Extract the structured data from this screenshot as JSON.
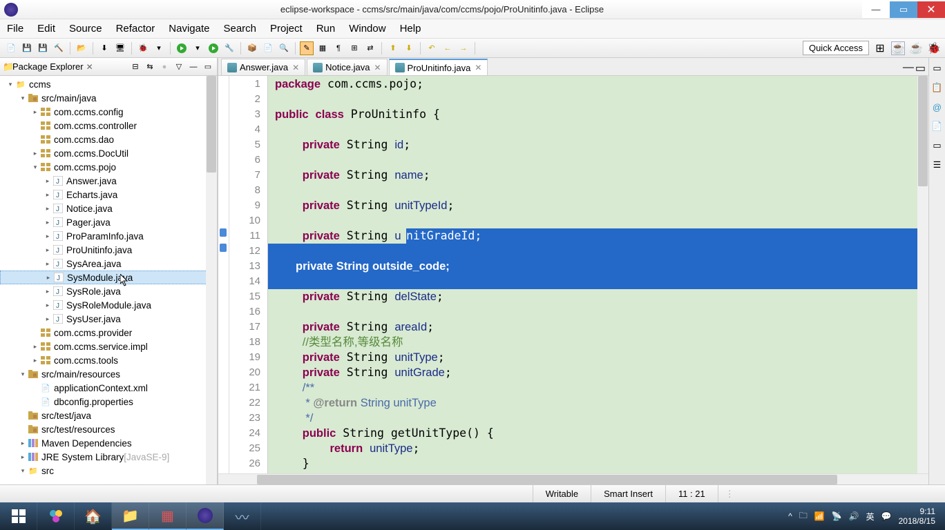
{
  "window": {
    "title": "eclipse-workspace - ccms/src/main/java/com/ccms/pojo/ProUnitinfo.java - Eclipse"
  },
  "menu": {
    "items": [
      "File",
      "Edit",
      "Source",
      "Refactor",
      "Navigate",
      "Search",
      "Project",
      "Run",
      "Window",
      "Help"
    ]
  },
  "quickaccess": "Quick Access",
  "explorer": {
    "title": "Package Explorer",
    "nodes": [
      {
        "d": 0,
        "tw": "▾",
        "icon": "project",
        "label": "ccms"
      },
      {
        "d": 1,
        "tw": "▾",
        "icon": "srcfolder",
        "label": "src/main/java"
      },
      {
        "d": 2,
        "tw": "▸",
        "icon": "pkg",
        "label": "com.ccms.config"
      },
      {
        "d": 2,
        "tw": "",
        "icon": "pkg",
        "label": "com.ccms.controller"
      },
      {
        "d": 2,
        "tw": "",
        "icon": "pkg",
        "label": "com.ccms.dao"
      },
      {
        "d": 2,
        "tw": "▸",
        "icon": "pkg",
        "label": "com.ccms.DocUtil"
      },
      {
        "d": 2,
        "tw": "▾",
        "icon": "pkg",
        "label": "com.ccms.pojo"
      },
      {
        "d": 3,
        "tw": "▸",
        "icon": "java",
        "label": "Answer.java"
      },
      {
        "d": 3,
        "tw": "▸",
        "icon": "java",
        "label": "Echarts.java"
      },
      {
        "d": 3,
        "tw": "▸",
        "icon": "java",
        "label": "Notice.java"
      },
      {
        "d": 3,
        "tw": "▸",
        "icon": "java",
        "label": "Pager.java"
      },
      {
        "d": 3,
        "tw": "▸",
        "icon": "java",
        "label": "ProParamInfo.java"
      },
      {
        "d": 3,
        "tw": "▸",
        "icon": "java",
        "label": "ProUnitinfo.java"
      },
      {
        "d": 3,
        "tw": "▸",
        "icon": "java",
        "label": "SysArea.java"
      },
      {
        "d": 3,
        "tw": "▸",
        "icon": "java",
        "label": "SysModule.java",
        "sel": true
      },
      {
        "d": 3,
        "tw": "▸",
        "icon": "java",
        "label": "SysRole.java"
      },
      {
        "d": 3,
        "tw": "▸",
        "icon": "java",
        "label": "SysRoleModule.java"
      },
      {
        "d": 3,
        "tw": "▸",
        "icon": "java",
        "label": "SysUser.java"
      },
      {
        "d": 2,
        "tw": "",
        "icon": "pkg",
        "label": "com.ccms.provider"
      },
      {
        "d": 2,
        "tw": "▸",
        "icon": "pkg",
        "label": "com.ccms.service.impl"
      },
      {
        "d": 2,
        "tw": "▸",
        "icon": "pkg",
        "label": "com.ccms.tools"
      },
      {
        "d": 1,
        "tw": "▾",
        "icon": "srcfolder",
        "label": "src/main/resources"
      },
      {
        "d": 2,
        "tw": "",
        "icon": "file",
        "label": "applicationContext.xml"
      },
      {
        "d": 2,
        "tw": "",
        "icon": "file",
        "label": "dbconfig.properties"
      },
      {
        "d": 1,
        "tw": "",
        "icon": "srcfolder",
        "label": "src/test/java"
      },
      {
        "d": 1,
        "tw": "",
        "icon": "srcfolder",
        "label": "src/test/resources"
      },
      {
        "d": 1,
        "tw": "▸",
        "icon": "lib",
        "label": "Maven Dependencies"
      },
      {
        "d": 1,
        "tw": "▸",
        "icon": "lib",
        "label": "JRE System Library",
        "extra": "[JavaSE-9]"
      },
      {
        "d": 1,
        "tw": "▾",
        "icon": "folder",
        "label": "src"
      }
    ]
  },
  "editor": {
    "tabs": [
      {
        "label": "Answer.java",
        "active": false
      },
      {
        "label": "Notice.java",
        "active": false
      },
      {
        "label": "ProUnitinfo.java",
        "active": true
      }
    ],
    "lines_start": 1,
    "lines_end": 26,
    "code_html": "<span class='kw'>package</span> com.ccms.pojo;\n\n<span class='kw'>public</span> <span class='kw'>class</span> ProUnitinfo {\n\n    <span class='kw'>private</span> String <span class='fld'>id</span>;\n\n    <span class='kw'>private</span> String <span class='fld'>name</span>;\n\n    <span class='kw'>private</span> String <span class='fld'>unitTypeId</span>;\n\n    <span class='kw'>private</span> String <span class='fld'>u</span>\n\n\n\n    <span class='kw'>private</span> String <span class='fld'>delState</span>;\n\n    <span class='kw'>private</span> String <span class='fld'>areaId</span>;\n    <span class='cmt'>//类型名称,等级名称</span>\n    <span class='kw'>private</span> String <span class='fld'>unitType</span>;\n    <span class='kw'>private</span> String <span class='fld'>unitGrade</span>;\n    <span class='jdoc'>/**</span>\n    <span class='jdoc'> * <span class='jtag'>@return</span> String unitType</span>\n    <span class='jdoc'> */</span>\n    <span class='kw'>public</span> String getUnitType() {\n        <span class='kw'>return</span> <span class='fld'>unitType</span>;\n    }",
    "selection": {
      "line11_tail": "nitGradeId;",
      "line13": "private String outside_code;"
    }
  },
  "status": {
    "writable": "Writable",
    "insert": "Smart Insert",
    "pos": "11 : 21"
  },
  "tray": {
    "ime": "英",
    "time": "9:11",
    "date": "2018/8/15"
  }
}
